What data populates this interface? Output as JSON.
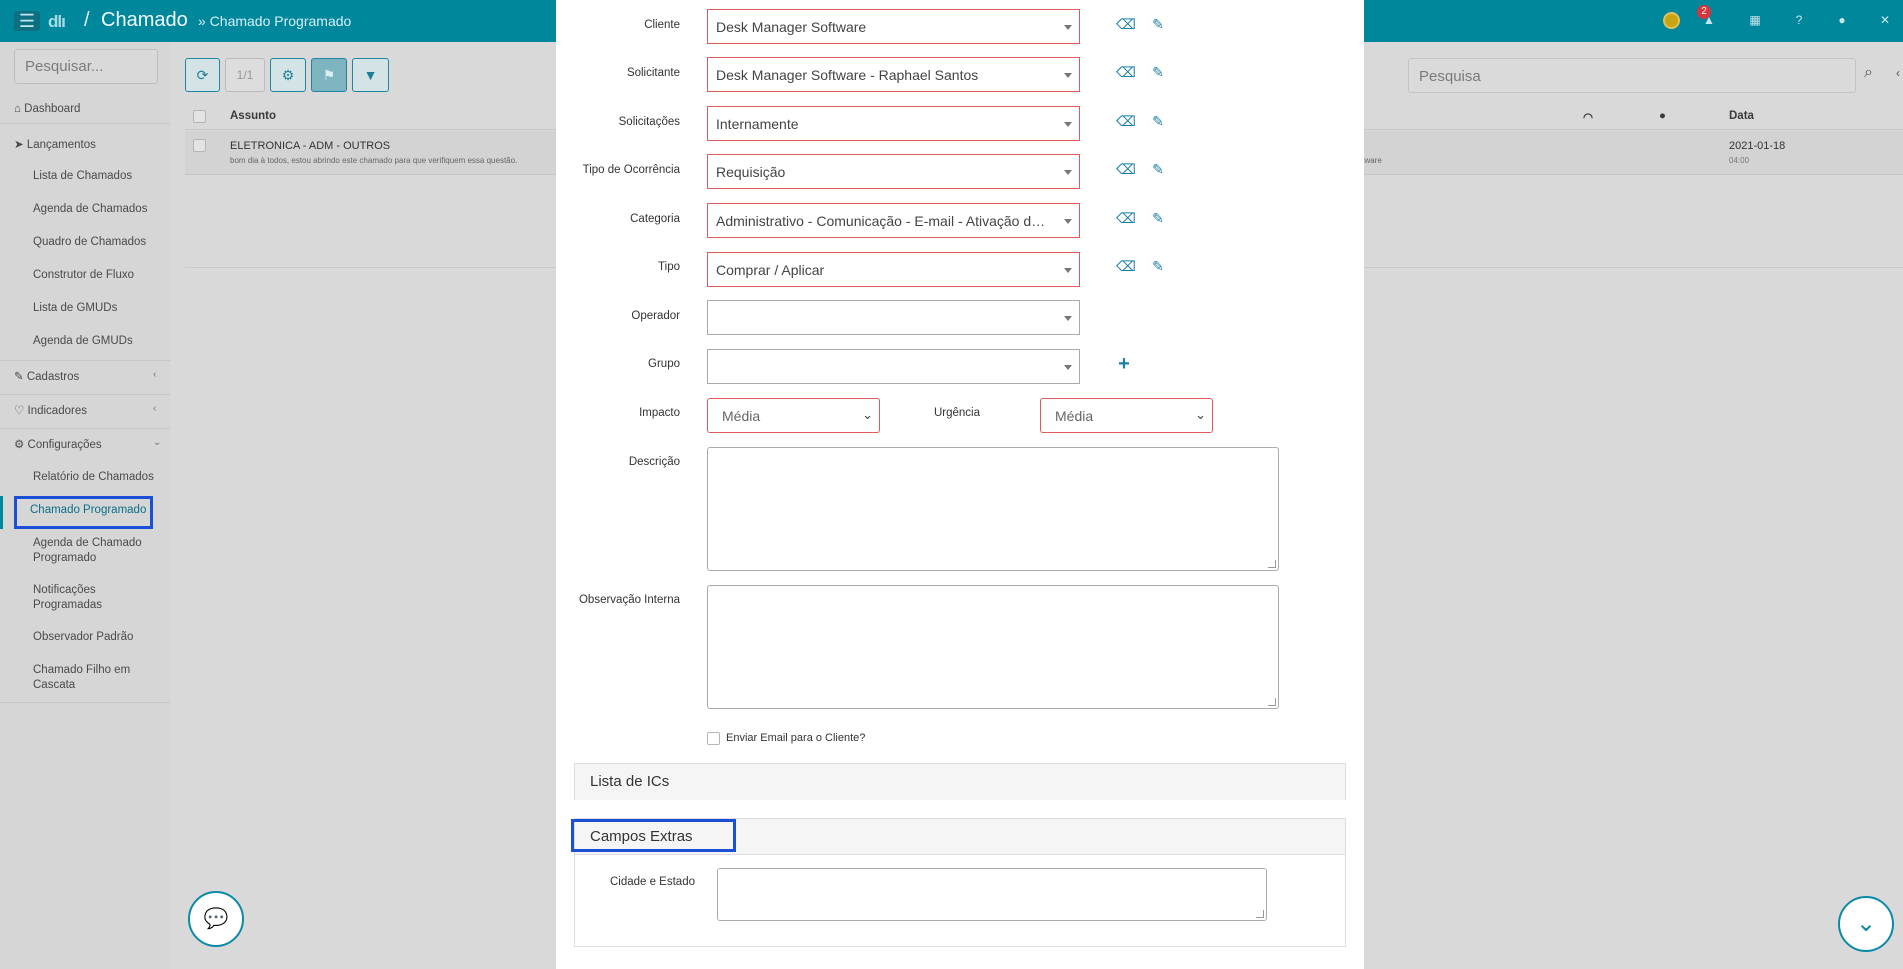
{
  "topbar": {
    "menu_icon": "hamburger-icon",
    "logo": "dlı",
    "separator": "/",
    "app_title": "Chamado",
    "breadcrumb": "» Chamado Programado",
    "notification_count": "2"
  },
  "sidebar": {
    "search_placeholder": "Pesquisar...",
    "items": [
      {
        "label": "Dashboard",
        "icon": "dashboard-icon"
      },
      {
        "label": "Lançamentos",
        "icon": "paper-plane-icon"
      },
      {
        "label": "Lista de Chamados"
      },
      {
        "label": "Agenda de Chamados"
      },
      {
        "label": "Quadro de Chamados"
      },
      {
        "label": "Construtor de Fluxo"
      },
      {
        "label": "Lista de GMUDs"
      },
      {
        "label": "Agenda de GMUDs"
      },
      {
        "label": "Cadastros",
        "icon": "edit-icon"
      },
      {
        "label": "Indicadores",
        "icon": "heart-icon"
      },
      {
        "label": "Configurações",
        "icon": "gear-icon"
      },
      {
        "label": "Relatório de Chamados"
      },
      {
        "label": "Chamado Programado"
      },
      {
        "label": "Agenda de Chamado Programado"
      },
      {
        "label": "Notificações Programadas"
      },
      {
        "label": "Observador Padrão"
      },
      {
        "label": "Chamado Filho em Cascata"
      }
    ]
  },
  "list": {
    "pager": "1/1",
    "search_placeholder": "Pesquisa",
    "col_subject": "Assunto",
    "col_date": "Data",
    "row": {
      "subject": "ELETRONICA - ADM - OUTROS",
      "preview": "bom dia à todos, estou abrindo este chamado para que verifiquem essa questão.",
      "owner_fragment": "ftware",
      "date": "2021-01-18",
      "time": "04:00"
    }
  },
  "form": {
    "cliente": {
      "label": "Cliente",
      "value": "Desk Manager Software"
    },
    "solicitante": {
      "label": "Solicitante",
      "value": "Desk Manager Software - Raphael Santos"
    },
    "solicitacoes": {
      "label": "Solicitações",
      "value": "Internamente"
    },
    "tipo_ocorrencia": {
      "label": "Tipo de Ocorrência",
      "value": "Requisição"
    },
    "categoria": {
      "label": "Categoria",
      "value": "Administrativo - Comunicação - E-mail - Ativação de Li..."
    },
    "tipo": {
      "label": "Tipo",
      "value": "Comprar / Aplicar"
    },
    "operador": {
      "label": "Operador",
      "value": ""
    },
    "grupo": {
      "label": "Grupo",
      "value": ""
    },
    "impacto": {
      "label": "Impacto",
      "value": "Média"
    },
    "urgencia": {
      "label": "Urgência",
      "value": "Média"
    },
    "descricao": {
      "label": "Descrição"
    },
    "observacao": {
      "label": "Observação Interna"
    },
    "enviar_email": {
      "label": "Enviar Email para o Cliente?"
    },
    "panel_ics": "Lista de ICs",
    "panel_extras": "Campos Extras",
    "cidade_estado": {
      "label": "Cidade e Estado"
    }
  },
  "colors": {
    "topbar": "#00879b",
    "error_border": "#e05a5a",
    "highlight": "#1a4fd6",
    "accent": "#1b7fa6"
  }
}
